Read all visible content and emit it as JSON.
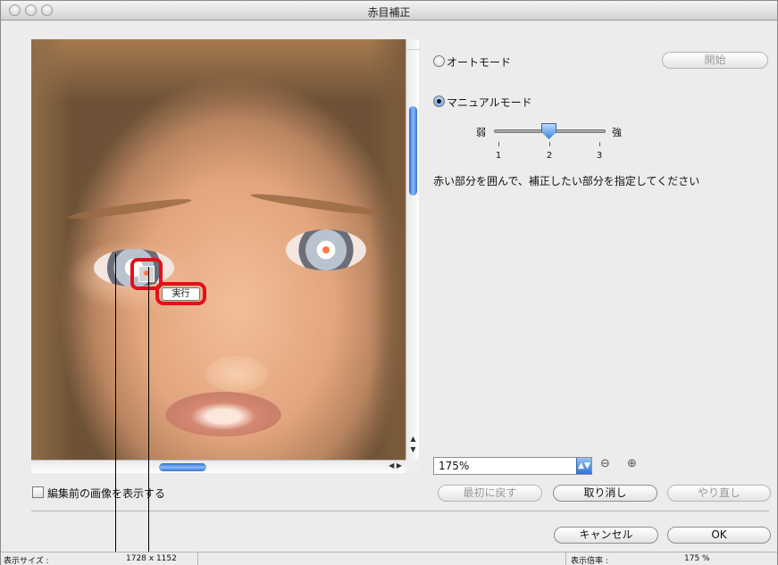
{
  "window": {
    "title": "赤目補正"
  },
  "execute_label": "実行",
  "auto_mode": {
    "label": "オートモード",
    "selected": false,
    "start_label": "開始"
  },
  "manual_mode": {
    "label": "マニュアルモード",
    "selected": true
  },
  "strength": {
    "weak_label": "弱",
    "strong_label": "強",
    "ticks": [
      "1",
      "2",
      "3"
    ],
    "value": 2
  },
  "instruction": "赤い部分を囲んで、補正したい部分を指定してください",
  "zoom": {
    "value": "175%"
  },
  "show_original": {
    "label": "編集前の画像を表示する",
    "checked": false
  },
  "buttons": {
    "reset": "最初に戻す",
    "undo": "取り消し",
    "redo": "やり直し",
    "cancel": "キャンセル",
    "ok": "OK"
  },
  "status": {
    "size_label": "表示サイズ :",
    "size_value": "1728 x 1152",
    "ratio_label": "表示倍率 :",
    "ratio_value": "175 %"
  },
  "colors": {
    "highlight": "#e3101a",
    "accent": "#3574d8"
  }
}
